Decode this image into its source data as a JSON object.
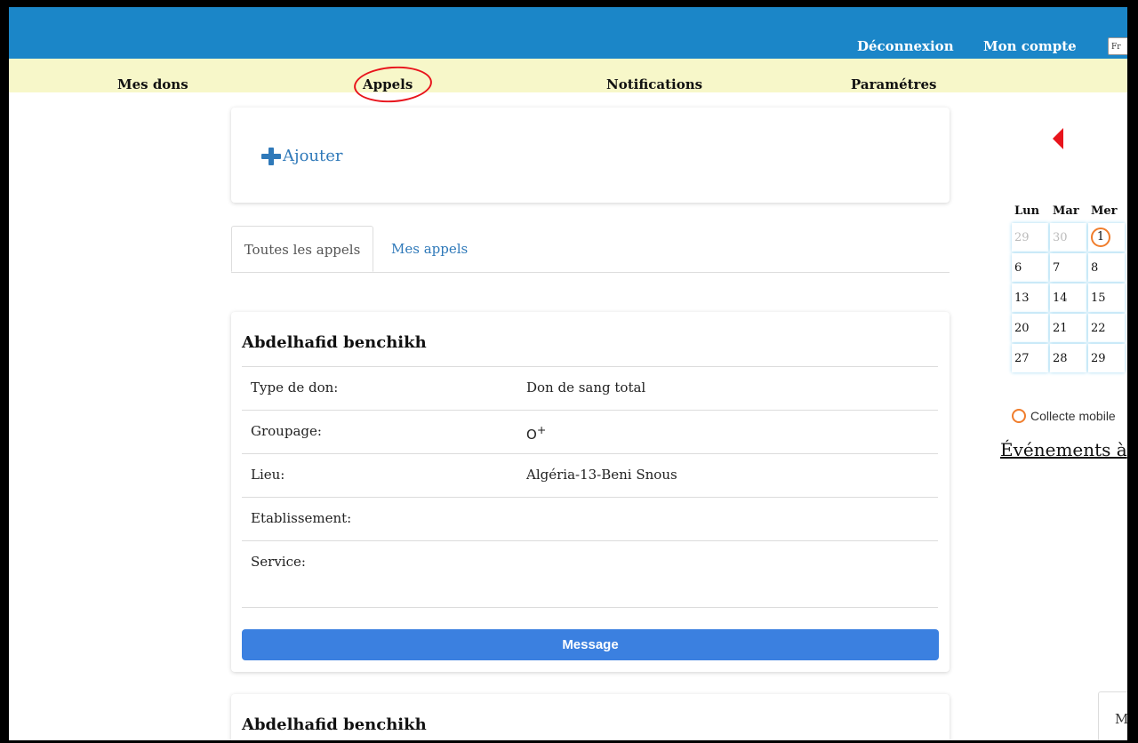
{
  "header": {
    "logout_label": "Déconnexion",
    "account_label": "Mon compte",
    "language_label": "Fr"
  },
  "nav": {
    "items": [
      "Mes dons",
      "Appels",
      "Notifications",
      "Paramétres"
    ],
    "highlighted": "Appels"
  },
  "actions": {
    "add_label": "Ajouter"
  },
  "tabs": {
    "all_label": "Toutes les appels",
    "mine_label": "Mes appels",
    "active": "Toutes les appels"
  },
  "appeals": [
    {
      "name": "Abdelhafid benchikh",
      "fields": [
        {
          "label": "Type de don:",
          "value": "Don de sang total"
        },
        {
          "label": "Groupage:",
          "value": "O+"
        },
        {
          "label": "Lieu:",
          "value": "Algéria-13-Beni Snous"
        },
        {
          "label": "Etablissement:",
          "value": ""
        },
        {
          "label": "Service:",
          "value": ""
        }
      ],
      "button_label": "Message"
    },
    {
      "name": "Abdelhafid benchikh"
    }
  ],
  "calendar": {
    "weekdays": [
      "Lun",
      "Mar",
      "Mer"
    ],
    "weeks": [
      [
        "29",
        "30",
        "1"
      ],
      [
        "6",
        "7",
        "8"
      ],
      [
        "13",
        "14",
        "15"
      ],
      [
        "20",
        "21",
        "22"
      ],
      [
        "27",
        "28",
        "29"
      ]
    ],
    "legend_label": "Collecte mobile",
    "events_title": "Événements à",
    "highlight_color": "#f07d2c"
  },
  "corner_label": "M",
  "colors": {
    "topbar": "#1b86c8",
    "navbar": "#f7f7c9",
    "link": "#2f79b9",
    "button": "#3b80e0",
    "annotation": "#e8141c"
  }
}
